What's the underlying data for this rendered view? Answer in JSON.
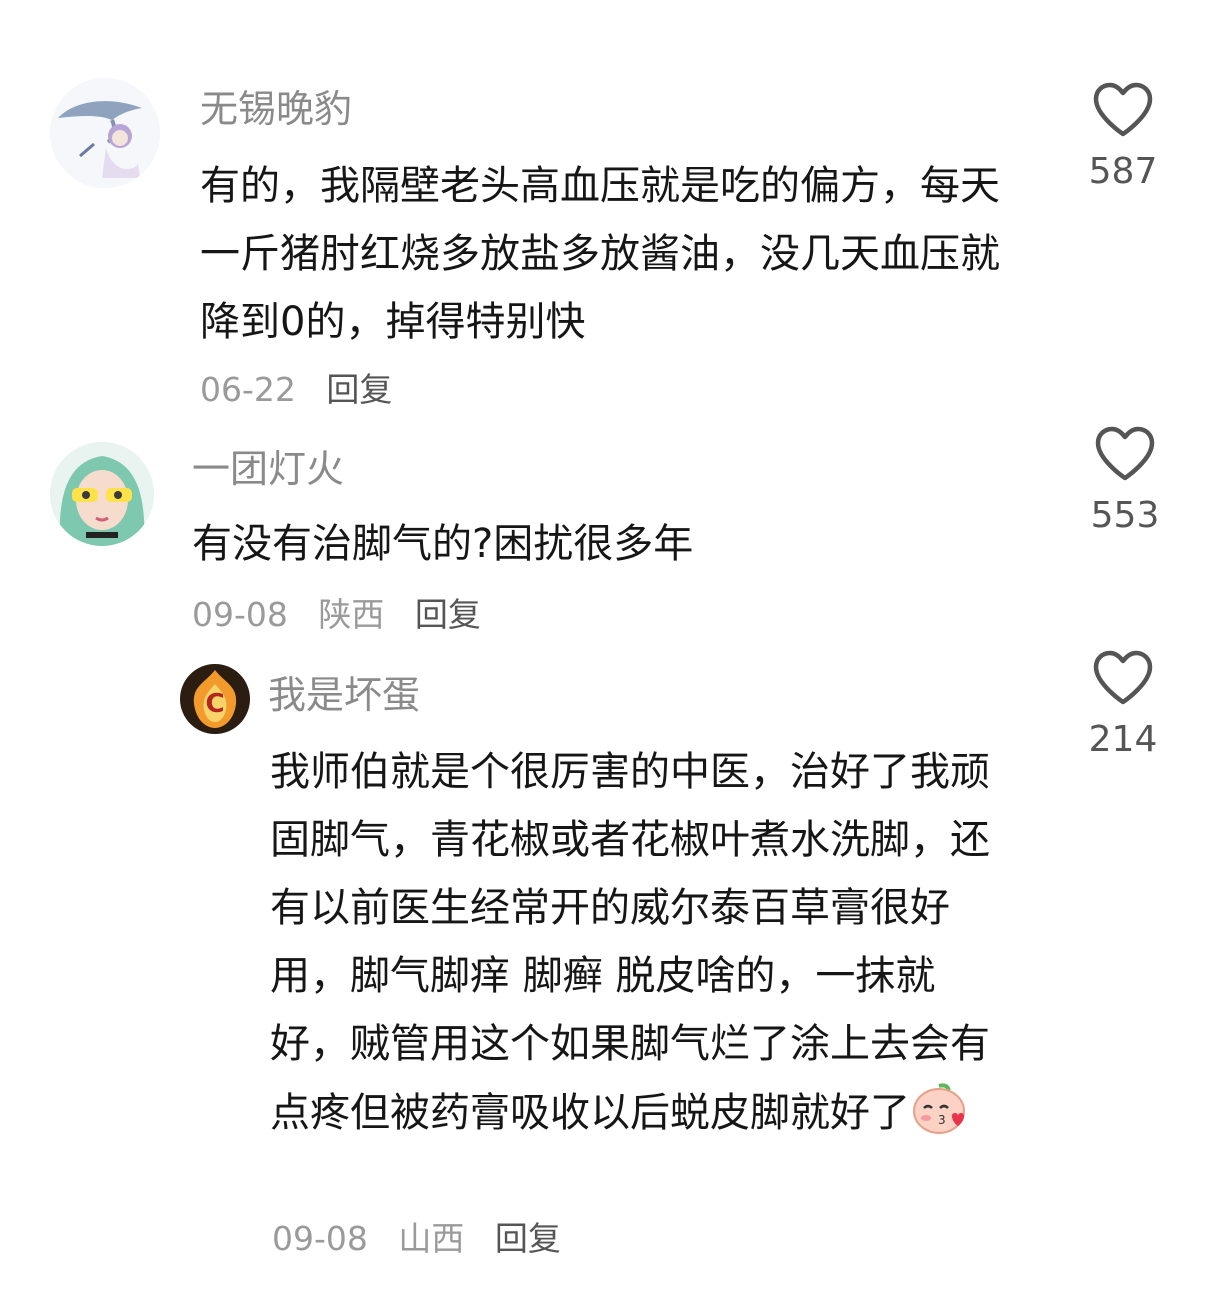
{
  "comments": [
    {
      "username": "无锡晚豹",
      "text": "有的，我隔壁老头高血压就是吃的偏方，每天一斤猪肘红烧多放盐多放酱油，没几天血压就降到0的，掉得特别快",
      "date": "06-22",
      "location": "",
      "reply_label": "回复",
      "likes": "587",
      "avatar_icon": "dolphin-avatar-icon"
    },
    {
      "username": "一团灯火",
      "text": "有没有治脚气的?困扰很多年",
      "date": "09-08",
      "location": "陕西",
      "reply_label": "回复",
      "likes": "553",
      "avatar_icon": "girl-avatar-icon"
    },
    {
      "username": "我是坏蛋",
      "text": "我师伯就是个很厉害的中医，治好了我顽固脚气，青花椒或者花椒叶煮水洗脚，还有以前医生经常开的威尔泰百草膏很好用，脚气脚痒 脚癣 脱皮啥的，一抹就好，贼管用这个如果脚气烂了涂上去会有点疼但被药膏吸收以后蜕皮脚就好了",
      "date": "09-08",
      "location": "山西",
      "reply_label": "回复",
      "likes": "214",
      "avatar_icon": "flame-avatar-icon",
      "emoji_icon": "peach-kiss-emoji-icon"
    }
  ],
  "colors": {
    "username": "#8a8a8a",
    "text": "#161616",
    "meta": "#9a9a9a",
    "heart": "#555555"
  }
}
